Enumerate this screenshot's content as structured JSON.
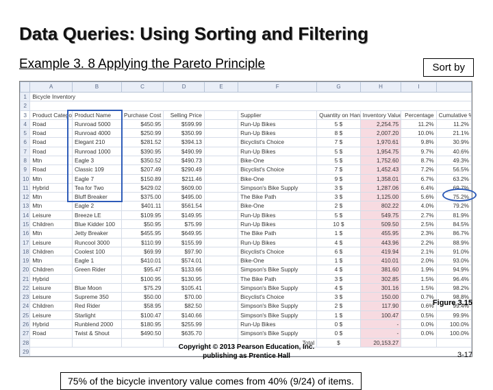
{
  "title": "Data Queries: Using Sorting and Filtering",
  "example": "Example 3. 8   Applying the Pareto Principle",
  "sort_by": "Sort by",
  "caption": "75% of the bicycle inventory value comes from 40% (9/24) of items.",
  "figure_label": "Figure 3.15",
  "copyright_line1": "Copyright © 2013 Pearson Education, Inc.",
  "copyright_line2": "publishing as Prentice Hall",
  "page_number": "3-17",
  "sheet_title": "Bicycle Inventory",
  "cols": [
    "",
    "A",
    "B",
    "C",
    "D",
    "E",
    "F",
    "G",
    "H",
    "I",
    ""
  ],
  "header": [
    "Product Category",
    "Product Name",
    "Purchase Cost",
    "Selling Price",
    "",
    "Supplier",
    "Quantity on Hand",
    "Inventory Value",
    "Percentage",
    "Cumulative %"
  ],
  "rows": [
    {
      "n": 4,
      "cat": "Road",
      "name": "Runroad 5000",
      "pc": "$450.95",
      "sp": "$599.99",
      "sup": "Run-Up Bikes",
      "q": "5",
      "iv": "2,254.75",
      "pct": "11.2%",
      "cum": "11.2%"
    },
    {
      "n": 5,
      "cat": "Road",
      "name": "Runroad 4000",
      "pc": "$250.99",
      "sp": "$350.99",
      "sup": "Run-Up Bikes",
      "q": "8",
      "iv": "2,007.20",
      "pct": "10.0%",
      "cum": "21.1%"
    },
    {
      "n": 6,
      "cat": "Road",
      "name": "Elegant 210",
      "pc": "$281.52",
      "sp": "$394.13",
      "sup": "Bicyclist's Choice",
      "q": "7",
      "iv": "1,970.61",
      "pct": "9.8%",
      "cum": "30.9%"
    },
    {
      "n": 7,
      "cat": "Road",
      "name": "Runroad 1000",
      "pc": "$390.95",
      "sp": "$490.99",
      "sup": "Run-Up Bikes",
      "q": "5",
      "iv": "1,954.75",
      "pct": "9.7%",
      "cum": "40.6%"
    },
    {
      "n": 8,
      "cat": "Mtn",
      "name": "Eagle 3",
      "pc": "$350.52",
      "sp": "$490.73",
      "sup": "Bike-One",
      "q": "5",
      "iv": "1,752.60",
      "pct": "8.7%",
      "cum": "49.3%"
    },
    {
      "n": 9,
      "cat": "Road",
      "name": "Classic 109",
      "pc": "$207.49",
      "sp": "$290.49",
      "sup": "Bicyclist's Choice",
      "q": "7",
      "iv": "1,452.43",
      "pct": "7.2%",
      "cum": "56.5%"
    },
    {
      "n": 10,
      "cat": "Mtn",
      "name": "Eagle 7",
      "pc": "$150.89",
      "sp": "$211.46",
      "sup": "Bike-One",
      "q": "9",
      "iv": "1,358.01",
      "pct": "6.7%",
      "cum": "63.2%"
    },
    {
      "n": 11,
      "cat": "Hybrid",
      "name": "Tea for Two",
      "pc": "$429.02",
      "sp": "$609.00",
      "sup": "Simpson's Bike Supply",
      "q": "3",
      "iv": "1,287.06",
      "pct": "6.4%",
      "cum": "69.7%"
    },
    {
      "n": 12,
      "cat": "Mtn",
      "name": "Bluff Breaker",
      "pc": "$375.00",
      "sp": "$495.00",
      "sup": "The Bike Path",
      "q": "3",
      "iv": "1,125.00",
      "pct": "5.6%",
      "cum": "75.2%"
    },
    {
      "n": 13,
      "cat": "Mtn",
      "name": "Eagle 2",
      "pc": "$401.11",
      "sp": "$561.54",
      "sup": "Bike-One",
      "q": "2",
      "iv": "802.22",
      "pct": "4.0%",
      "cum": "79.2%"
    },
    {
      "n": 14,
      "cat": "Leisure",
      "name": "Breeze LE",
      "pc": "$109.95",
      "sp": "$149.95",
      "sup": "Run-Up Bikes",
      "q": "5",
      "iv": "549.75",
      "pct": "2.7%",
      "cum": "81.9%"
    },
    {
      "n": 15,
      "cat": "Children",
      "name": "Blue Kidder 100",
      "pc": "$50.95",
      "sp": "$75.99",
      "sup": "Run-Up Bikes",
      "q": "10",
      "iv": "509.50",
      "pct": "2.5%",
      "cum": "84.5%"
    },
    {
      "n": 16,
      "cat": "Mtn",
      "name": "Jetty Breaker",
      "pc": "$455.95",
      "sp": "$649.95",
      "sup": "The Bike Path",
      "q": "1",
      "iv": "455.95",
      "pct": "2.3%",
      "cum": "86.7%"
    },
    {
      "n": 17,
      "cat": "Leisure",
      "name": "Runcool 3000",
      "pc": "$110.99",
      "sp": "$155.99",
      "sup": "Run-Up Bikes",
      "q": "4",
      "iv": "443.96",
      "pct": "2.2%",
      "cum": "88.9%"
    },
    {
      "n": 18,
      "cat": "Children",
      "name": "Coolest 100",
      "pc": "$69.99",
      "sp": "$97.90",
      "sup": "Bicyclist's Choice",
      "q": "6",
      "iv": "419.94",
      "pct": "2.1%",
      "cum": "91.0%"
    },
    {
      "n": 19,
      "cat": "Mtn",
      "name": "Eagle 1",
      "pc": "$410.01",
      "sp": "$574.01",
      "sup": "Bike-One",
      "q": "1",
      "iv": "410.01",
      "pct": "2.0%",
      "cum": "93.0%"
    },
    {
      "n": 20,
      "cat": "Children",
      "name": "Green Rider",
      "pc": "$95.47",
      "sp": "$133.66",
      "sup": "Simpson's Bike Supply",
      "q": "4",
      "iv": "381.60",
      "pct": "1.9%",
      "cum": "94.9%"
    },
    {
      "n": 21,
      "cat": "Hybrid",
      "name": "",
      "pc": "$100.95",
      "sp": "$130.95",
      "sup": "The Bike Path",
      "q": "3",
      "iv": "302.85",
      "pct": "1.5%",
      "cum": "96.4%"
    },
    {
      "n": 22,
      "cat": "Leisure",
      "name": "Blue Moon",
      "pc": "$75.29",
      "sp": "$105.41",
      "sup": "Simpson's Bike Supply",
      "q": "4",
      "iv": "301.16",
      "pct": "1.5%",
      "cum": "98.2%"
    },
    {
      "n": 23,
      "cat": "Leisure",
      "name": "Supreme 350",
      "pc": "$50.00",
      "sp": "$70.00",
      "sup": "Bicyclist's Choice",
      "q": "3",
      "iv": "150.00",
      "pct": "0.7%",
      "cum": "98.8%"
    },
    {
      "n": 24,
      "cat": "Children",
      "name": "Red Rider",
      "pc": "$58.95",
      "sp": "$82.50",
      "sup": "Simpson's Bike Supply",
      "q": "2",
      "iv": "117.90",
      "pct": "0.6%",
      "cum": "99.4%"
    },
    {
      "n": 25,
      "cat": "Leisure",
      "name": "Starlight",
      "pc": "$100.47",
      "sp": "$140.66",
      "sup": "Simpson's Bike Supply",
      "q": "1",
      "iv": "100.47",
      "pct": "0.5%",
      "cum": "99.9%"
    },
    {
      "n": 26,
      "cat": "Hybrid",
      "name": "Runblend 2000",
      "pc": "$180.95",
      "sp": "$255.99",
      "sup": "Run-Up Bikes",
      "q": "0",
      "iv": "-",
      "pct": "0.0%",
      "cum": "100.0%"
    },
    {
      "n": 27,
      "cat": "Road",
      "name": "Twist & Shout",
      "pc": "$490.50",
      "sp": "$635.70",
      "sup": "Simpson's Bike Supply",
      "q": "0",
      "iv": "-",
      "pct": "0.0%",
      "cum": "100.0%"
    }
  ],
  "total_label": "Total",
  "total_cur": "$",
  "total_value": "20,153.27"
}
